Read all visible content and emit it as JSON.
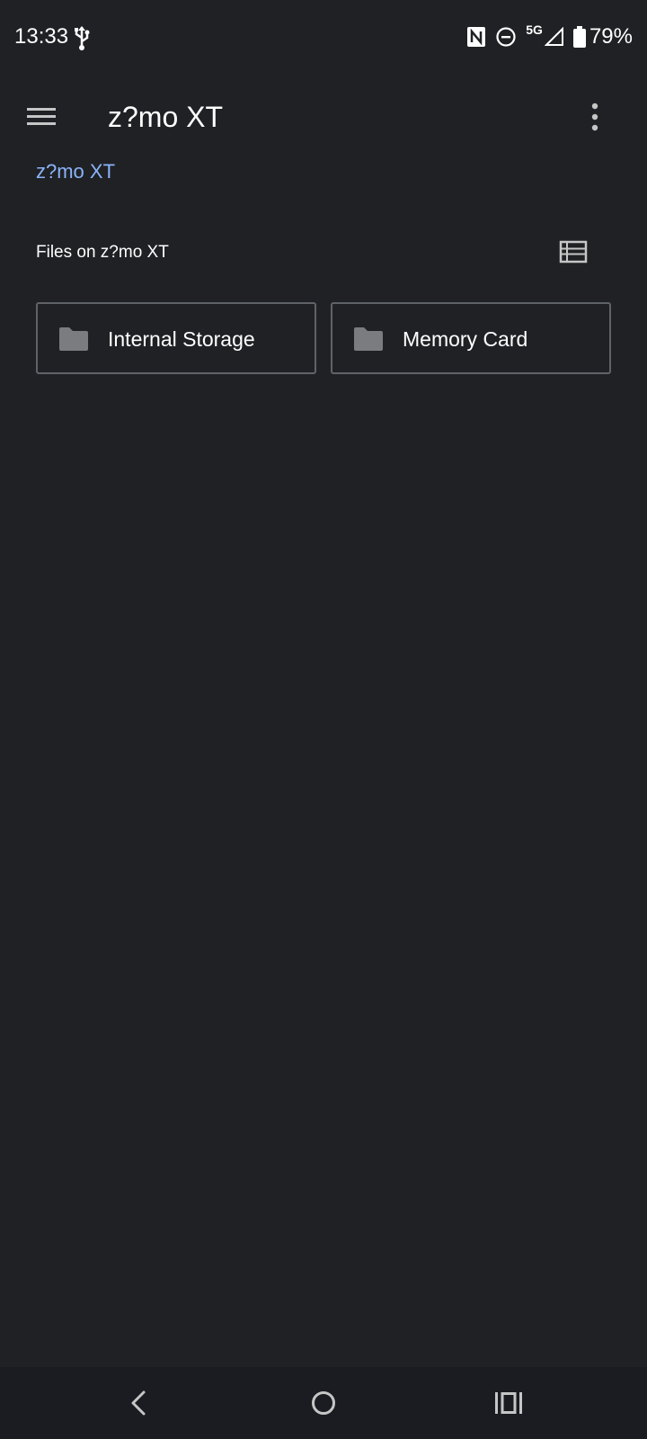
{
  "status_bar": {
    "time": "13:33",
    "network": "5G",
    "battery": "79%",
    "icons": [
      "usb-icon",
      "nfc-icon",
      "do-not-disturb-icon",
      "signal-icon",
      "battery-icon"
    ]
  },
  "app_bar": {
    "title": "z?mo XT",
    "menu_icon": "menu-icon",
    "overflow_icon": "more-vert-icon"
  },
  "breadcrumb": {
    "current": "z?mo XT"
  },
  "section": {
    "header": "Files on z?mo XT",
    "view_toggle_icon": "list-view-icon"
  },
  "storage": {
    "items": [
      {
        "label": "Internal Storage",
        "icon": "folder-icon"
      },
      {
        "label": "Memory Card",
        "icon": "folder-icon"
      }
    ]
  },
  "nav_bar": {
    "icons": [
      "back-icon",
      "home-icon",
      "recents-icon"
    ]
  },
  "colors": {
    "background": "#202125",
    "accent": "#8ab4f8",
    "tile_border": "#5f6368",
    "folder": "#7a7c80"
  }
}
